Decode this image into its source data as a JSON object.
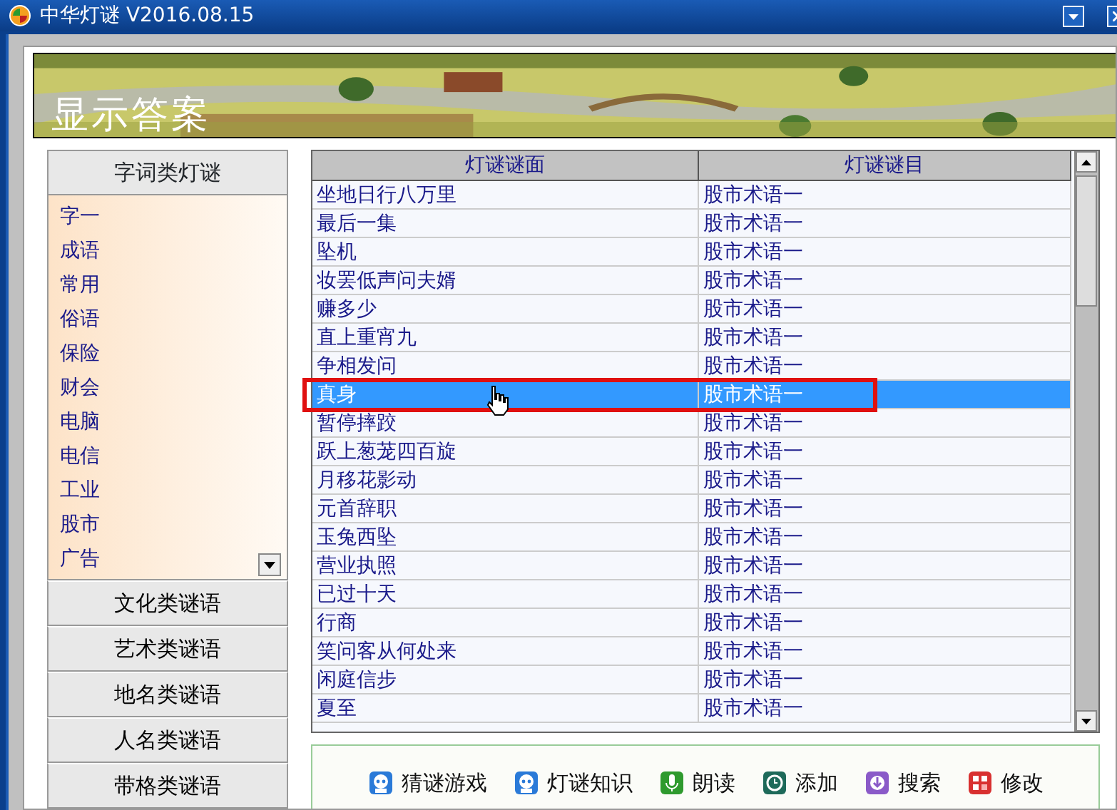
{
  "window": {
    "title": "中华灯谜 V2016.08.15"
  },
  "banner": {
    "title": "显示答案"
  },
  "sidebar": {
    "header": "字词类灯谜",
    "items": [
      {
        "label": "字一"
      },
      {
        "label": "成语"
      },
      {
        "label": "常用"
      },
      {
        "label": "俗语"
      },
      {
        "label": "保险"
      },
      {
        "label": "财会"
      },
      {
        "label": "电脑"
      },
      {
        "label": "电信"
      },
      {
        "label": "工业"
      },
      {
        "label": "股市"
      },
      {
        "label": "广告"
      }
    ],
    "categories": [
      "文化类谜语",
      "艺术类谜语",
      "地名类谜语",
      "人名类谜语",
      "带格类谜语"
    ]
  },
  "table": {
    "columns": [
      "灯谜谜面",
      "灯谜谜目"
    ],
    "rows": [
      {
        "cells": [
          "坐地日行八万里",
          "股市术语一"
        ],
        "selected": false
      },
      {
        "cells": [
          "最后一集",
          "股市术语一"
        ],
        "selected": false
      },
      {
        "cells": [
          "坠机",
          "股市术语一"
        ],
        "selected": false
      },
      {
        "cells": [
          "妆罢低声问夫婿",
          "股市术语一"
        ],
        "selected": false
      },
      {
        "cells": [
          "赚多少",
          "股市术语一"
        ],
        "selected": false
      },
      {
        "cells": [
          "直上重宵九",
          "股市术语一"
        ],
        "selected": false
      },
      {
        "cells": [
          "争相发问",
          "股市术语一"
        ],
        "selected": false
      },
      {
        "cells": [
          "真身",
          "股市术语一"
        ],
        "selected": true
      },
      {
        "cells": [
          "暂停摔跤",
          "股市术语一"
        ],
        "selected": false
      },
      {
        "cells": [
          "跃上葱茏四百旋",
          "股市术语一"
        ],
        "selected": false
      },
      {
        "cells": [
          "月移花影动",
          "股市术语一"
        ],
        "selected": false
      },
      {
        "cells": [
          "元首辞职",
          "股市术语一"
        ],
        "selected": false
      },
      {
        "cells": [
          "玉兔西坠",
          "股市术语一"
        ],
        "selected": false
      },
      {
        "cells": [
          "营业执照",
          "股市术语一"
        ],
        "selected": false
      },
      {
        "cells": [
          "已过十天",
          "股市术语一"
        ],
        "selected": false
      },
      {
        "cells": [
          "行商",
          "股市术语一"
        ],
        "selected": false
      },
      {
        "cells": [
          "笑问客从何处来",
          "股市术语一"
        ],
        "selected": false
      },
      {
        "cells": [
          "闲庭信步",
          "股市术语一"
        ],
        "selected": false
      },
      {
        "cells": [
          "夏至",
          "股市术语一"
        ],
        "selected": false
      }
    ]
  },
  "toolbar": [
    {
      "label": "猜谜游戏",
      "kind": "robot"
    },
    {
      "label": "灯谜知识",
      "kind": "robot"
    },
    {
      "label": "朗读",
      "kind": "mic"
    },
    {
      "label": "添加",
      "kind": "clock"
    },
    {
      "label": "搜索",
      "kind": "download"
    },
    {
      "label": "修改",
      "kind": "grid"
    }
  ]
}
